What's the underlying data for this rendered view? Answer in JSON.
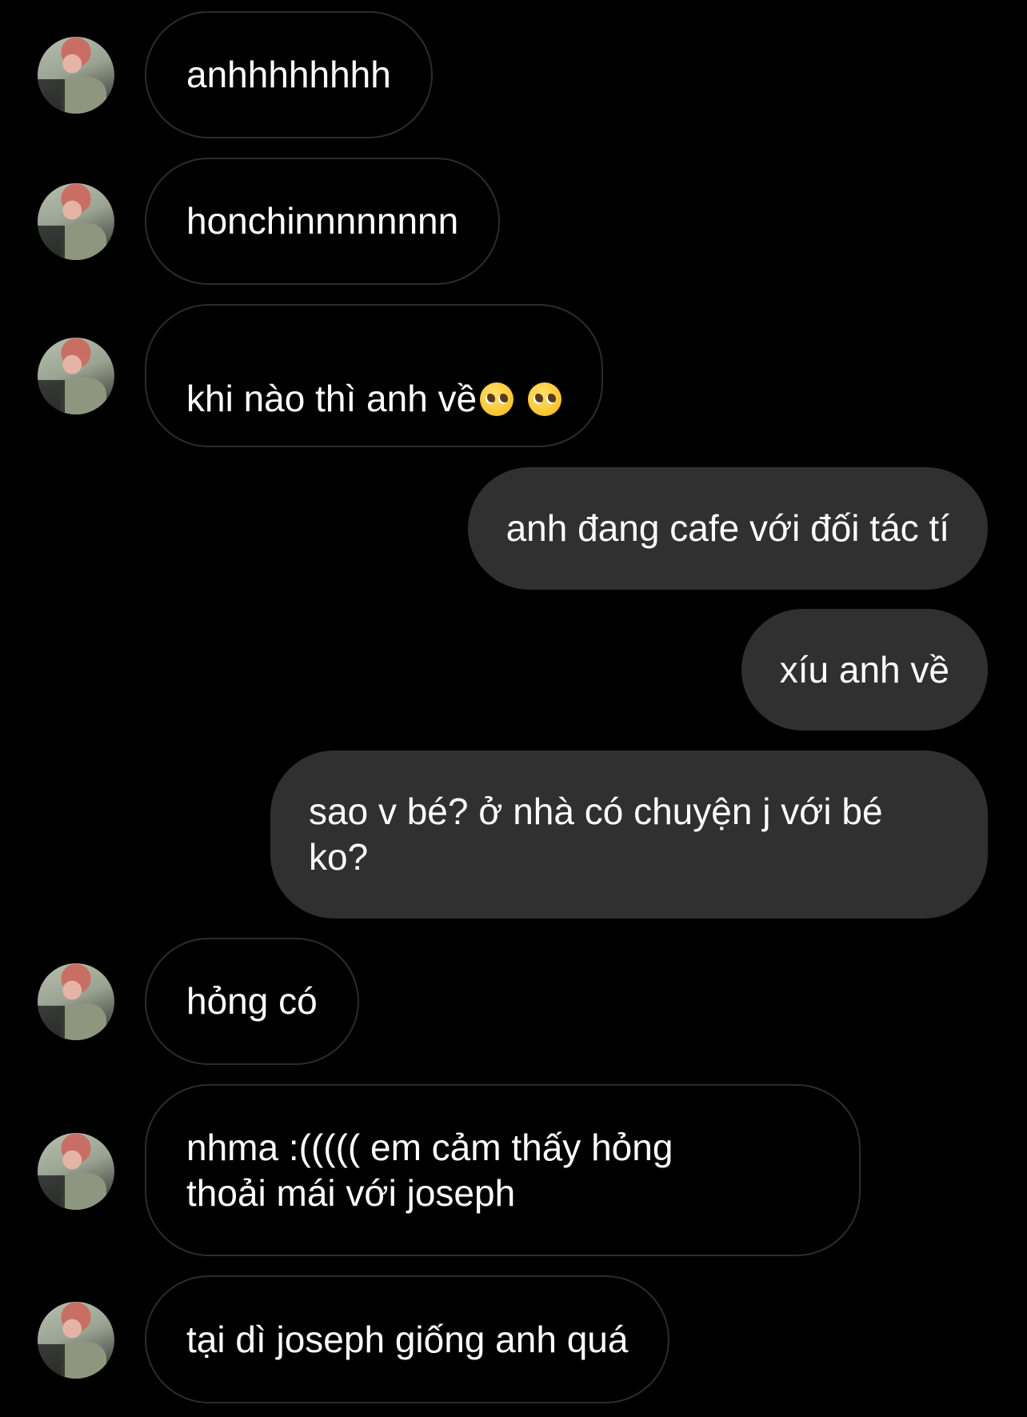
{
  "conversation": {
    "messages": [
      {
        "direction": "incoming",
        "text": "anhhhhhhhh"
      },
      {
        "direction": "incoming",
        "text": "honchinnnnnnnn"
      },
      {
        "direction": "incoming",
        "text": "khi nào thì anh về",
        "emojis": [
          "pleading-face",
          "pleading-face"
        ]
      },
      {
        "direction": "outgoing",
        "text": "anh đang cafe với đối tác tí"
      },
      {
        "direction": "outgoing",
        "text": "xíu anh về"
      },
      {
        "direction": "outgoing",
        "text": "sao v bé? ở nhà có chuyện j với bé\nko?"
      },
      {
        "direction": "incoming",
        "text": "hỏng có"
      },
      {
        "direction": "incoming",
        "text": "nhma :((((( em cảm thấy hỏng\nthoải mái với joseph"
      },
      {
        "direction": "incoming",
        "text": "tại dì joseph giống anh quá"
      }
    ]
  },
  "colors": {
    "background": "#000000",
    "incoming_border": "#2c2c2e",
    "outgoing_bubble": "#303030",
    "text": "#ffffff"
  }
}
